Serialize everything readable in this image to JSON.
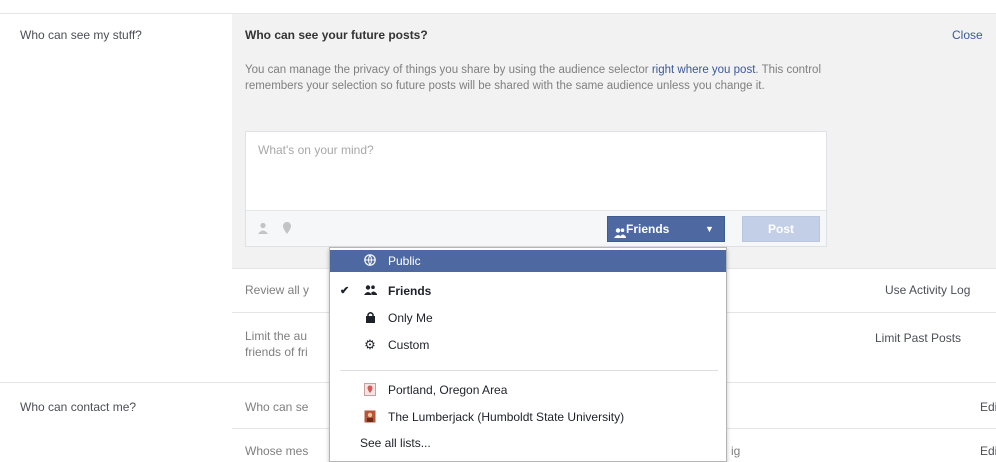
{
  "sections": {
    "stuff_label": "Who can see my stuff?",
    "contact_label": "Who can contact me?"
  },
  "future_posts": {
    "title": "Who can see your future posts?",
    "close_label": "Close",
    "desc_part1": "You can manage the privacy of things you share by using the audience selector",
    "desc_link": "right where you post",
    "desc_part2": ". This control remembers your selection so future posts will be shared with the same audience unless you change it.",
    "composer_placeholder": "What's on your mind?",
    "audience_button_label": "Friends",
    "post_button_label": "Post"
  },
  "rows": [
    {
      "text": "Review all your posts and things you're tagged in",
      "visible_text": "Review all y",
      "action": "Use Activity Log"
    },
    {
      "text_line1": "Limit the au",
      "text_line2": "friends of fri",
      "action": "Limit Past Posts"
    },
    {
      "text": "Who can se",
      "action": "Edit"
    },
    {
      "text": "Whose mes",
      "tail": "ig",
      "action": "Edit"
    }
  ],
  "audience_menu": {
    "items": [
      {
        "label": "Public",
        "icon": "globe-icon",
        "highlighted": true
      },
      {
        "label": "Friends",
        "icon": "friends-icon",
        "checked": true
      },
      {
        "label": "Only Me",
        "icon": "lock-icon"
      },
      {
        "label": "Custom",
        "icon": "gear-icon"
      }
    ],
    "lists": [
      {
        "label": "Portland, Oregon Area",
        "icon": "location-icon"
      },
      {
        "label": "The Lumberjack (Humboldt State University)",
        "icon": "group-icon"
      }
    ],
    "see_all_label": "See all lists..."
  },
  "colors": {
    "accent": "#4e69a2",
    "link": "#3b5998",
    "panel_bg": "#f2f2f2"
  }
}
